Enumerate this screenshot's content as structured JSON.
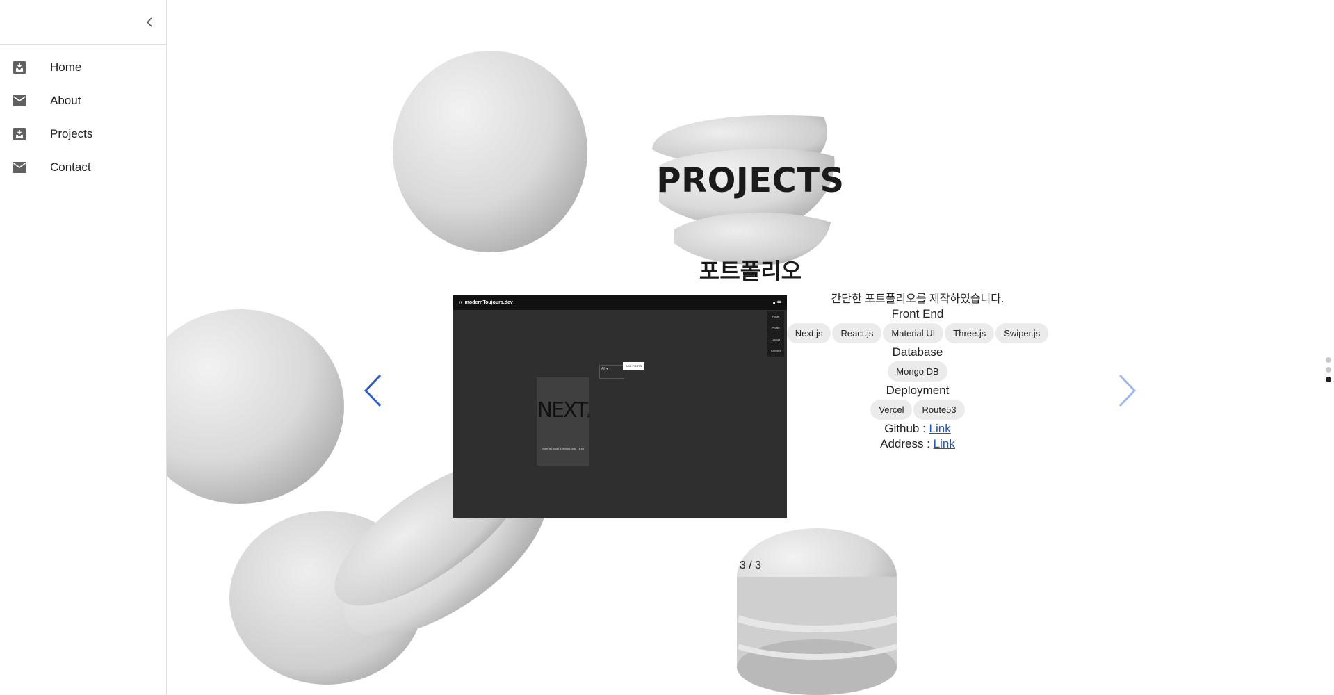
{
  "sidebar": {
    "collapse_icon": "chevron-left-icon",
    "items": [
      {
        "label": "Home",
        "icon": "inbox-download-icon"
      },
      {
        "label": "About",
        "icon": "mail-icon"
      },
      {
        "label": "Projects",
        "icon": "inbox-download-icon"
      },
      {
        "label": "Contact",
        "icon": "mail-icon"
      }
    ]
  },
  "main": {
    "page_title": "PROJECTS",
    "slide": {
      "title": "포트폴리오",
      "description": "간단한 포트폴리오를 제작하였습니다.",
      "screenshot": {
        "site_name": "modernToujours.dev",
        "menu": [
          "Posts",
          "Profile",
          "Logout",
          "Contact"
        ],
        "filter_value": "All",
        "button_label": "ADD POSTS",
        "logo_text": "NEXT.js",
        "card_caption": "[Next.js] Build & Invalid URL TEST"
      },
      "sections": [
        {
          "heading": "Front End",
          "chips": [
            "Next.js",
            "React.js",
            "Material UI",
            "Three.js",
            "Swiper.js"
          ]
        },
        {
          "heading": "Database",
          "chips": [
            "Mongo DB"
          ]
        },
        {
          "heading": "Deployment",
          "chips": [
            "Vercel",
            "Route53"
          ]
        }
      ],
      "github": {
        "label": "Github : ",
        "link_text": "Link"
      },
      "address": {
        "label": "Address : ",
        "link_text": "Link"
      }
    },
    "pagination": "3 / 3",
    "prev_icon": "chevron-left-icon",
    "next_icon": "chevron-right-icon",
    "section_dots": {
      "count": 3,
      "active_index": 2
    }
  },
  "colors": {
    "accent_link": "#1a57c9",
    "prev_arrow": "#2b5bd7",
    "next_arrow": "#9db8ee",
    "chip_bg": "#ebebeb"
  }
}
